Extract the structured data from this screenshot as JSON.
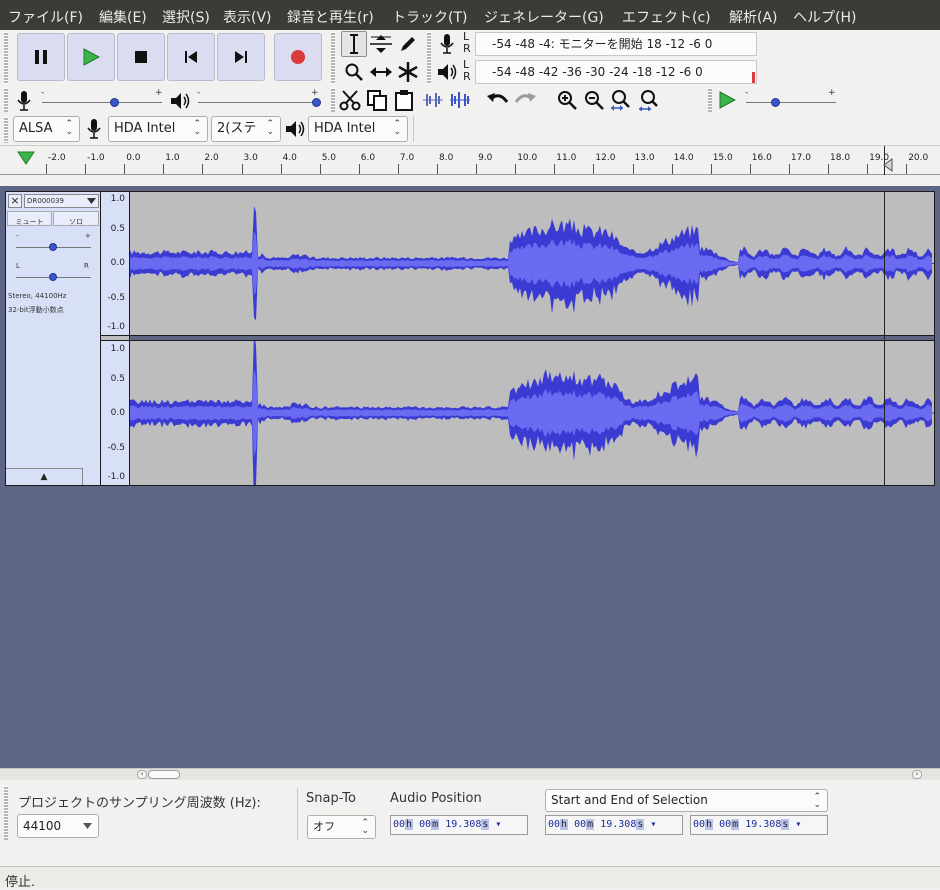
{
  "menubar": {
    "items": [
      "ファイル(F)",
      "編集(E)",
      "選択(S)",
      "表示(V)",
      "録音と再生(r)",
      "トラック(T)",
      "ジェネレーター(G)",
      "エフェクト(c)",
      "解析(A)",
      "ヘルプ(H)"
    ]
  },
  "meters": {
    "record_channels": [
      "L",
      "R"
    ],
    "record_scale": "-54  -48  -4: モニターを開始  18   -12   -6    0",
    "play_channels": [
      "L",
      "R"
    ],
    "play_scale": "-54  -48  -42  -36  -30  -24  -18  -12   -6    0"
  },
  "sliders": {
    "minus": "-",
    "plus": "+"
  },
  "devices": {
    "host": "ALSA",
    "record_device": "HDA Intel",
    "channels": "2(ステ",
    "play_device": "HDA Intel"
  },
  "ruler": {
    "labels": [
      "-2.0",
      "-1.0",
      "0.0",
      "1.0",
      "2.0",
      "3.0",
      "4.0",
      "5.0",
      "6.0",
      "7.0",
      "8.0",
      "9.0",
      "10.0",
      "11.0",
      "12.0",
      "13.0",
      "14.0",
      "15.0",
      "16.0",
      "17.0",
      "18.0",
      "19.0",
      "20.0"
    ]
  },
  "track": {
    "name": "DR000039",
    "mute_label": "ミュート",
    "solo_label": "ソロ",
    "gain_minus": "-",
    "gain_plus": "+",
    "pan_left": "L",
    "pan_right": "R",
    "info_rate": "Stereo, 44100Hz",
    "info_format": "32-bit浮動小数点",
    "close_glyph": "×",
    "collapse_glyph": "▲",
    "vruler_top": [
      "1.0",
      "0.5",
      "0.0",
      "-0.5",
      "-1.0"
    ],
    "vruler_bottom": [
      "1.0",
      "0.5",
      "0.0",
      "-0.5",
      "-1.0"
    ]
  },
  "selection_bar": {
    "rate_label": "プロジェクトのサンプリング周波数 (Hz):",
    "rate_value": "44100",
    "snap_label": "Snap-To",
    "snap_value": "オフ",
    "audio_position_label": "Audio Position",
    "selection_mode": "Start and End of Selection",
    "time_parts": {
      "h_digits": "00",
      "h_unit": "h",
      "m_digits": "00",
      "m_unit": "m",
      "s_digits": "19.308",
      "s_unit": "s"
    }
  },
  "status": {
    "text": "停止."
  },
  "colors": {
    "menubar_bg": "#3c3b37",
    "track_bg": "#5f6584",
    "waveform": "#3b3bd3",
    "waveform_rms": "#6b6bf2",
    "wave_bg": "#bdbdbd",
    "play_green": "#3bb54a",
    "record_red": "#d93a3a"
  }
}
